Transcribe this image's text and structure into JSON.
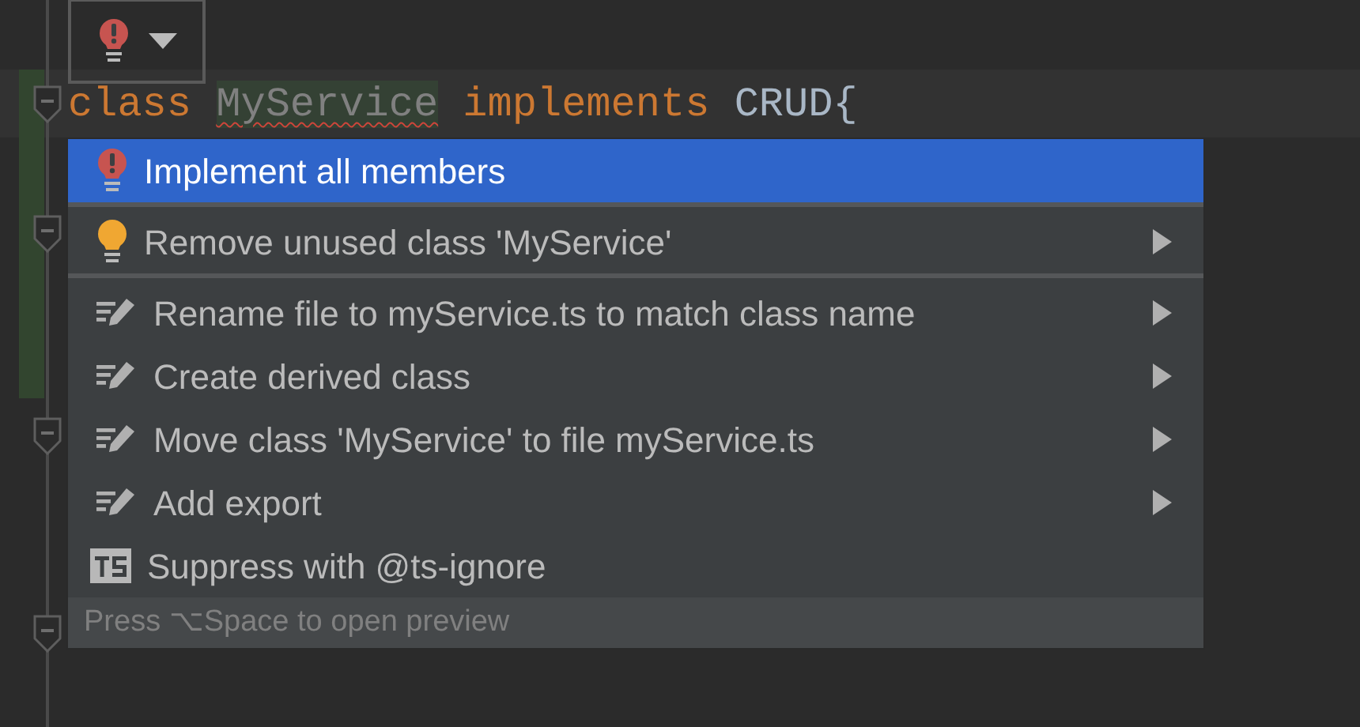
{
  "intention_button": {
    "kind": "error"
  },
  "code_line": [
    {
      "text": "class",
      "kind": "keyword"
    },
    {
      "text": "MyService",
      "kind": "unused"
    },
    {
      "text": "implements",
      "kind": "keyword"
    },
    {
      "text": "CRUD{",
      "kind": "plain"
    }
  ],
  "menu": {
    "groups": [
      [
        {
          "label": "Implement all members",
          "kind": "error",
          "selected": true,
          "submenu": false
        }
      ],
      [
        {
          "label": "Remove unused class 'MyService'",
          "kind": "bulb",
          "selected": false,
          "submenu": true
        }
      ],
      [
        {
          "label": "Rename file to myService.ts to match class name",
          "kind": "edit",
          "selected": false,
          "submenu": true
        },
        {
          "label": "Create derived class",
          "kind": "edit",
          "selected": false,
          "submenu": true
        },
        {
          "label": "Move class 'MyService' to file myService.ts",
          "kind": "edit",
          "selected": false,
          "submenu": true
        },
        {
          "label": "Add export",
          "kind": "edit",
          "selected": false,
          "submenu": true
        },
        {
          "label": "Suppress with @ts-ignore",
          "kind": "ts",
          "selected": false,
          "submenu": false
        }
      ]
    ],
    "footer": "Press ⌥Space to open preview"
  }
}
